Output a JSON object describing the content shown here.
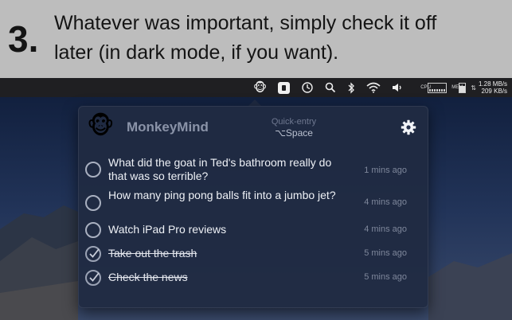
{
  "banner": {
    "step": "3.",
    "line1": "Whatever was important, simply check it off",
    "line2": "later (in dark mode, if you want)."
  },
  "menubar": {
    "icons": [
      "monkey-icon",
      "pocket-icon",
      "time-machine-icon",
      "search-icon",
      "bluetooth-icon",
      "wifi-icon",
      "volume-icon"
    ],
    "cpu_label": "CPU",
    "mem_label": "MEM",
    "net_up": "1.28 MB/s",
    "net_down": "209 KB/s"
  },
  "popover": {
    "app_name": "MonkeyMind",
    "logo": "🐵",
    "quick_entry_label": "Quick-entry",
    "quick_entry_shortcut": "⌥Space",
    "settings_icon": "gear-icon"
  },
  "tasks": [
    {
      "text": "What did the goat in Ted's bathroom really do that was so terrible?",
      "time": "1 mins ago",
      "done": false
    },
    {
      "text": "How many ping pong balls fit into a jumbo jet?",
      "time": "4 mins ago",
      "done": false
    },
    {
      "text": "Watch iPad Pro reviews",
      "time": "4 mins ago",
      "done": false
    },
    {
      "text": "Take out the trash",
      "time": "5 mins ago",
      "done": true
    },
    {
      "text": "Check the news",
      "time": "5 mins ago",
      "done": true
    }
  ]
}
